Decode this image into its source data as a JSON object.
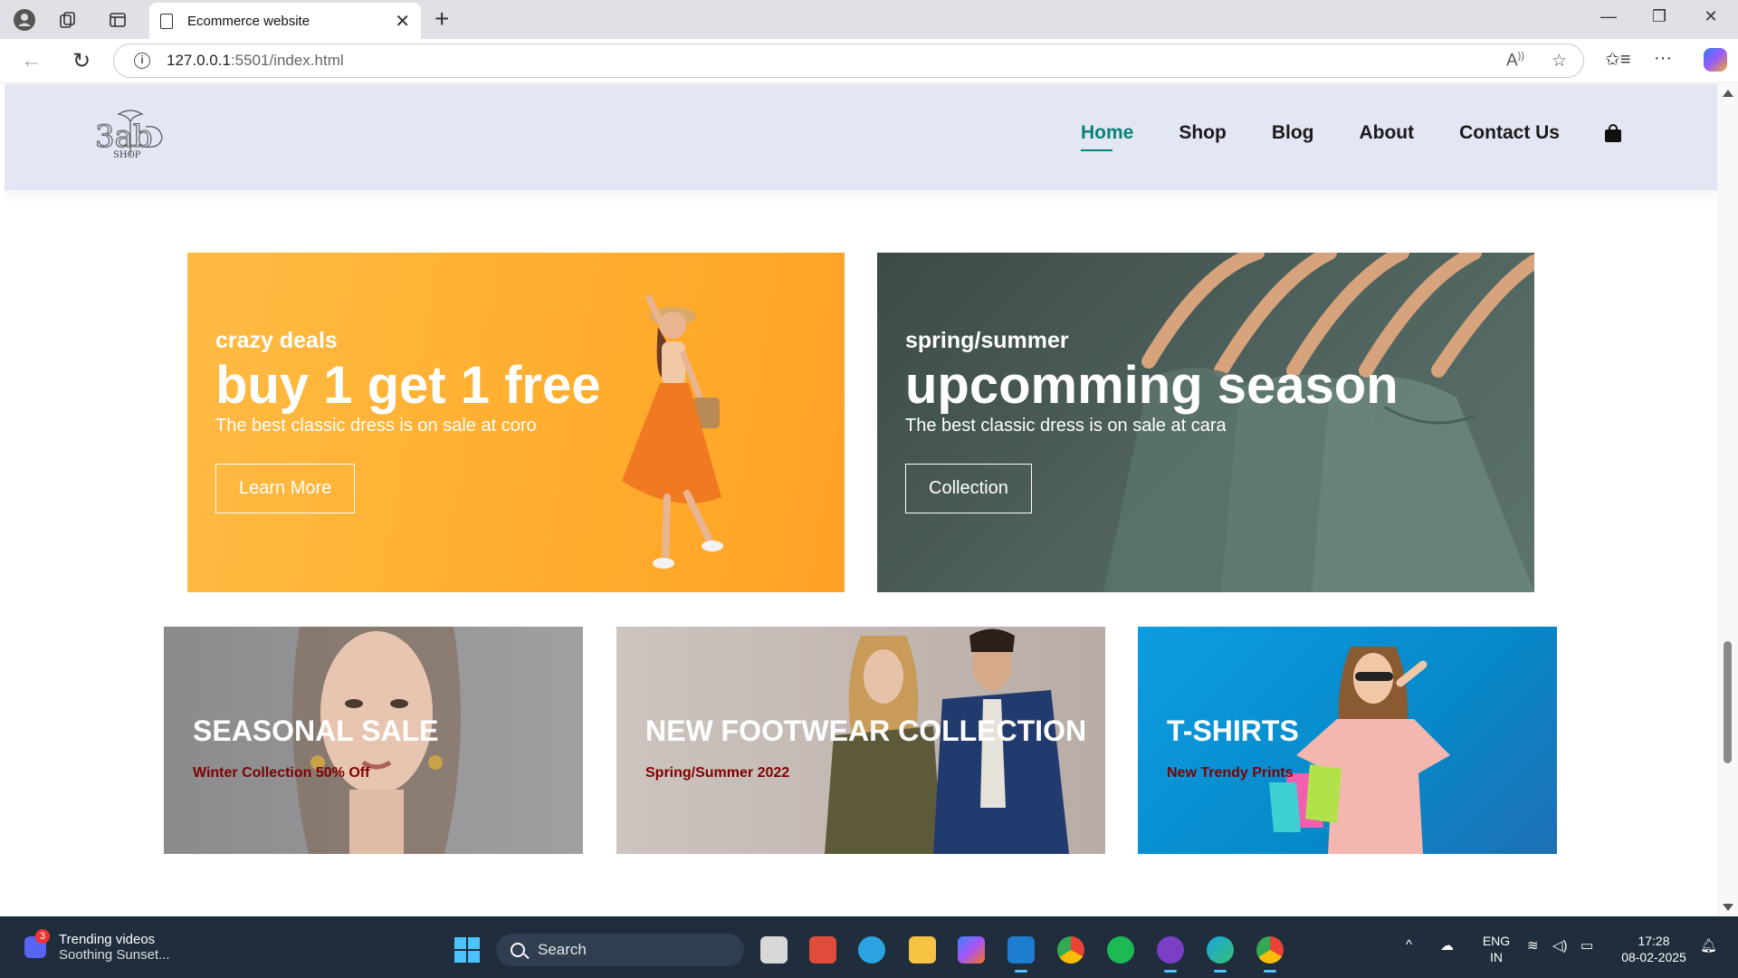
{
  "browser": {
    "tab_title": "Ecommerce website",
    "url_host": "127.0.0.1",
    "url_rest": ":5501/index.html"
  },
  "site": {
    "logo_text": "SHOP",
    "nav": [
      "Home",
      "Shop",
      "Blog",
      "About",
      "Contact Us"
    ],
    "active_nav": "Home",
    "accent_color": "#088178",
    "header_bg": "#e3e6f3"
  },
  "banners": [
    {
      "kicker": "crazy deals",
      "headline": "buy 1 get 1 free",
      "desc": "The best classic dress is on sale at coro",
      "button": "Learn More"
    },
    {
      "kicker": "spring/summer",
      "headline": "upcomming season",
      "desc": "The best classic dress is on sale at cara",
      "button": "Collection"
    }
  ],
  "small_banners": [
    {
      "title": "SEASONAL SALE",
      "subtitle": "Winter Collection 50% Off"
    },
    {
      "title": "NEW FOOTWEAR COLLECTION",
      "subtitle": "Spring/Summer 2022"
    },
    {
      "title": "T-SHIRTS",
      "subtitle": "New Trendy Prints"
    }
  ],
  "taskbar": {
    "news_badge": "3",
    "news_title": "Trending videos",
    "news_sub": "Soothing Sunset...",
    "search_label": "Search",
    "lang_1": "ENG",
    "lang_2": "IN",
    "time": "17:28",
    "date": "08-02-2025"
  }
}
